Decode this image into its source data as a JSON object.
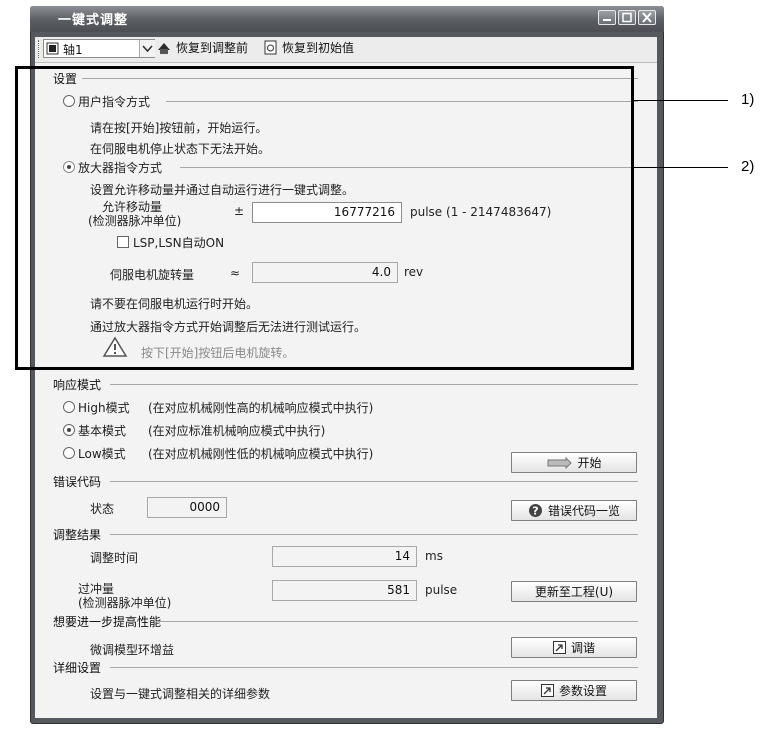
{
  "window": {
    "title": "一键式调整"
  },
  "toolbar": {
    "axis_value": "轴1",
    "restore_adjust": "恢复到调整前",
    "restore_initial": "恢复到初始值"
  },
  "settings": {
    "heading": "设置",
    "user_cmd": {
      "label": "用户指令方式",
      "line1": "请在按[开始]按钮前，开始运行。",
      "line2": "在伺服电机停止状态下无法开始。"
    },
    "amp_cmd": {
      "label": "放大器指令方式",
      "desc": "设置允许移动量并通过自动运行进行一键式调整。",
      "travel_label1": "允许移动量",
      "travel_label2": "(检测器脉冲单位)",
      "travel_sign": "±",
      "travel_value": "16777216",
      "travel_unit": "pulse (1 - 2147483647)",
      "lsp_label": "LSP,LSN自动ON",
      "rot_label": "伺服电机旋转量",
      "rot_sign": "≈",
      "rot_value": "4.0",
      "rot_unit": "rev",
      "note1": "请不要在伺服电机运行时开始。",
      "note2": "通过放大器指令方式开始调整后无法进行测试运行。",
      "warning": "按下[开始]按钮后电机旋转。"
    }
  },
  "response": {
    "heading": "响应模式",
    "high": {
      "label": "High模式",
      "desc": "(在对应机械刚性高的机械响应模式中执行)"
    },
    "basic": {
      "label": "基本模式",
      "desc": "(在对应标准机械响应模式中执行)"
    },
    "low": {
      "label": "Low模式",
      "desc": "(在对应机械刚性低的机械响应模式中执行)"
    },
    "start_button": "开始"
  },
  "error": {
    "heading": "错误代码",
    "status_label": "状态",
    "status_value": "0000",
    "list_button": "错误代码一览"
  },
  "result": {
    "heading": "调整结果",
    "time_label": "调整时间",
    "time_value": "14",
    "time_unit": "ms",
    "overshoot_label1": "过冲量",
    "overshoot_label2": "(检测器脉冲单位)",
    "overshoot_value": "581",
    "overshoot_unit": "pulse",
    "update_button": "更新至工程(U)"
  },
  "improve": {
    "heading": "想要进一步提高性能",
    "label": "微调模型环增益",
    "button": "调谐"
  },
  "detail": {
    "heading": "详细设置",
    "label": "设置与一键式调整相关的详细参数",
    "button": "参数设置"
  },
  "callouts": {
    "c1": "1)",
    "c2": "2)"
  }
}
